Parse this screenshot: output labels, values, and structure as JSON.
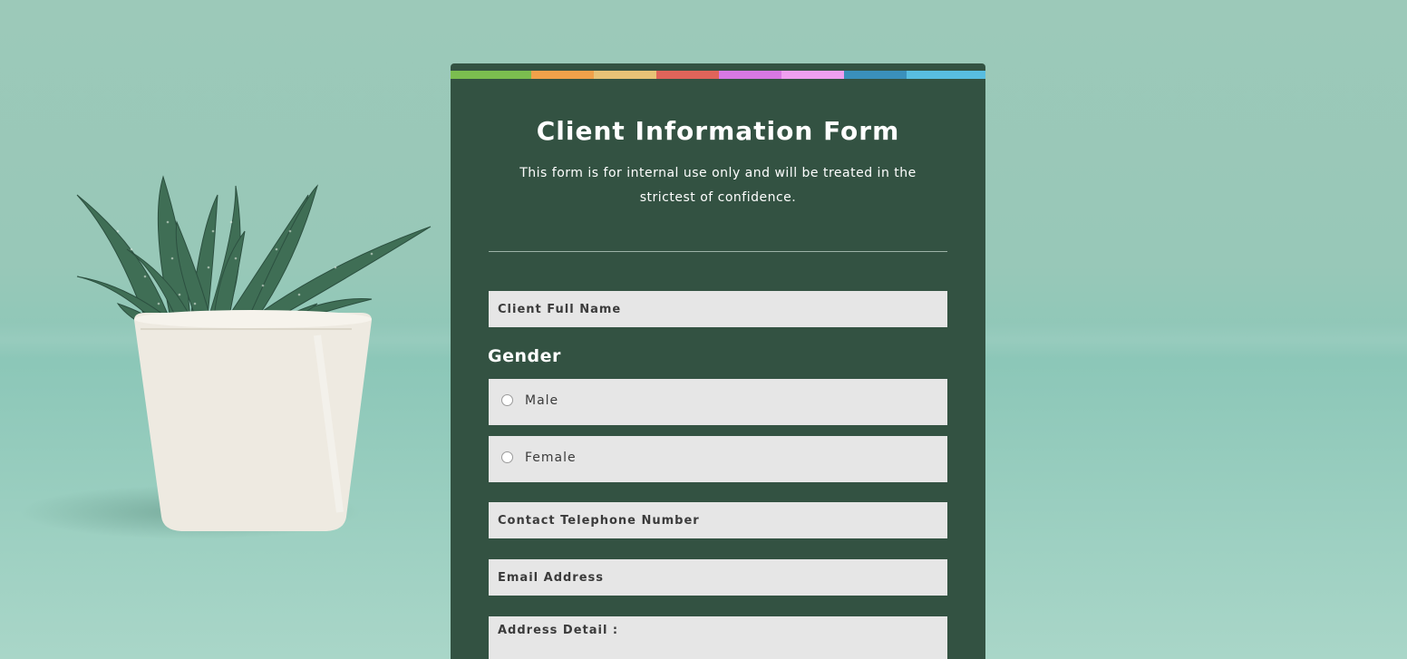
{
  "form": {
    "title": "Client Information Form",
    "subtitle": "This form is for internal use only and will be treated in the strictest of confidence.",
    "fields": {
      "full_name_placeholder": "Client Full Name",
      "telephone_placeholder": "Contact Telephone Number",
      "email_placeholder": "Email Address",
      "address_placeholder": "Address Detail :"
    },
    "gender": {
      "label": "Gender",
      "options": [
        "Male",
        "Female"
      ]
    },
    "accent_colors": [
      "#7bbd4f",
      "#f0a14a",
      "#e8c276",
      "#e0645a",
      "#d878e3",
      "#ef9ff0",
      "#3a90bb",
      "#58bde0"
    ]
  },
  "colors": {
    "card_background": "#335242",
    "field_background": "#e6e6e6",
    "page_background": "#9cc9b9"
  },
  "icons": {
    "background_decoration": "potted-succulent-plant"
  }
}
